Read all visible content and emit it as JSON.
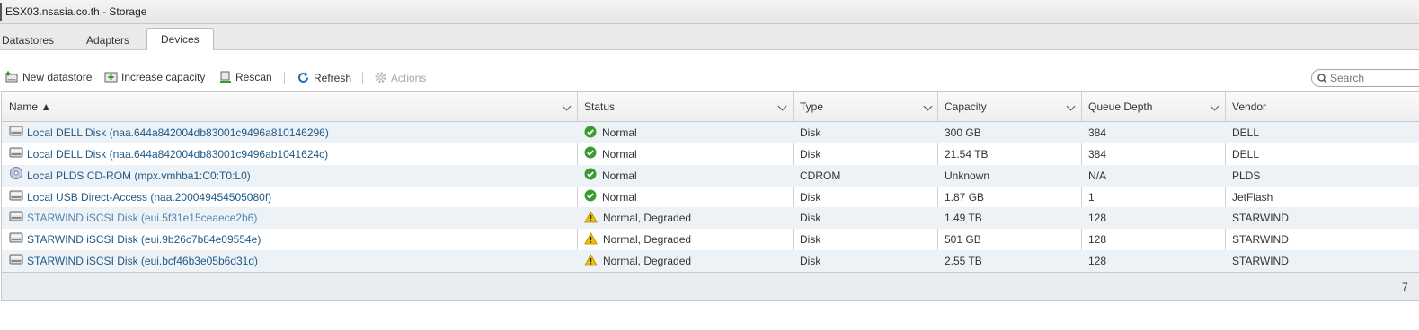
{
  "window": {
    "title": "ESX03.nsasia.co.th - Storage"
  },
  "tabs": [
    {
      "label": "Datastores",
      "active": false
    },
    {
      "label": "Adapters",
      "active": false
    },
    {
      "label": "Devices",
      "active": true
    }
  ],
  "toolbar": {
    "new_datastore": "New datastore",
    "increase_capacity": "Increase capacity",
    "rescan": "Rescan",
    "refresh": "Refresh",
    "actions": "Actions"
  },
  "search": {
    "placeholder": "Search"
  },
  "table": {
    "columns": [
      "Name ▲",
      "Status",
      "Type",
      "Capacity",
      "Queue Depth",
      "Vendor"
    ],
    "rows": [
      {
        "name": "Local DELL Disk (naa.644a842004db83001c9496a810146296)",
        "icon": "disk-icon",
        "status": "Normal",
        "status_icon": "check-icon",
        "type": "Disk",
        "capacity": "300 GB",
        "queue_depth": "384",
        "vendor": "DELL"
      },
      {
        "name": "Local DELL Disk (naa.644a842004db83001c9496ab1041624c)",
        "icon": "disk-icon",
        "status": "Normal",
        "status_icon": "check-icon",
        "type": "Disk",
        "capacity": "21.54 TB",
        "queue_depth": "384",
        "vendor": "DELL"
      },
      {
        "name": "Local PLDS CD-ROM (mpx.vmhba1:C0:T0:L0)",
        "icon": "cdrom-icon",
        "status": "Normal",
        "status_icon": "check-icon",
        "type": "CDROM",
        "capacity": "Unknown",
        "queue_depth": "N/A",
        "vendor": "PLDS"
      },
      {
        "name": "Local USB Direct-Access (naa.200049454505080f)",
        "icon": "disk-icon",
        "status": "Normal",
        "status_icon": "check-icon",
        "type": "Disk",
        "capacity": "1.87 GB",
        "queue_depth": "1",
        "vendor": "JetFlash"
      },
      {
        "name": "STARWIND iSCSI Disk (eui.5f31e15ceaece2b6)",
        "icon": "disk-icon",
        "status": "Normal, Degraded",
        "status_icon": "warning-icon",
        "type": "Disk",
        "capacity": "1.49 TB",
        "queue_depth": "128",
        "vendor": "STARWIND"
      },
      {
        "name": "STARWIND iSCSI Disk (eui.9b26c7b84e09554e)",
        "icon": "disk-icon",
        "status": "Normal, Degraded",
        "status_icon": "warning-icon",
        "type": "Disk",
        "capacity": "501 GB",
        "queue_depth": "128",
        "vendor": "STARWIND"
      },
      {
        "name": "STARWIND iSCSI Disk (eui.bcf46b3e05b6d31d)",
        "icon": "disk-icon",
        "status": "Normal, Degraded",
        "status_icon": "warning-icon",
        "type": "Disk",
        "capacity": "2.55 TB",
        "queue_depth": "128",
        "vendor": "STARWIND"
      }
    ],
    "footer_count": "7"
  },
  "colors": {
    "link": "#215a87",
    "ok": "#3a9b2f",
    "warning": "#f2c200",
    "row_alt": "#edf2f7"
  }
}
